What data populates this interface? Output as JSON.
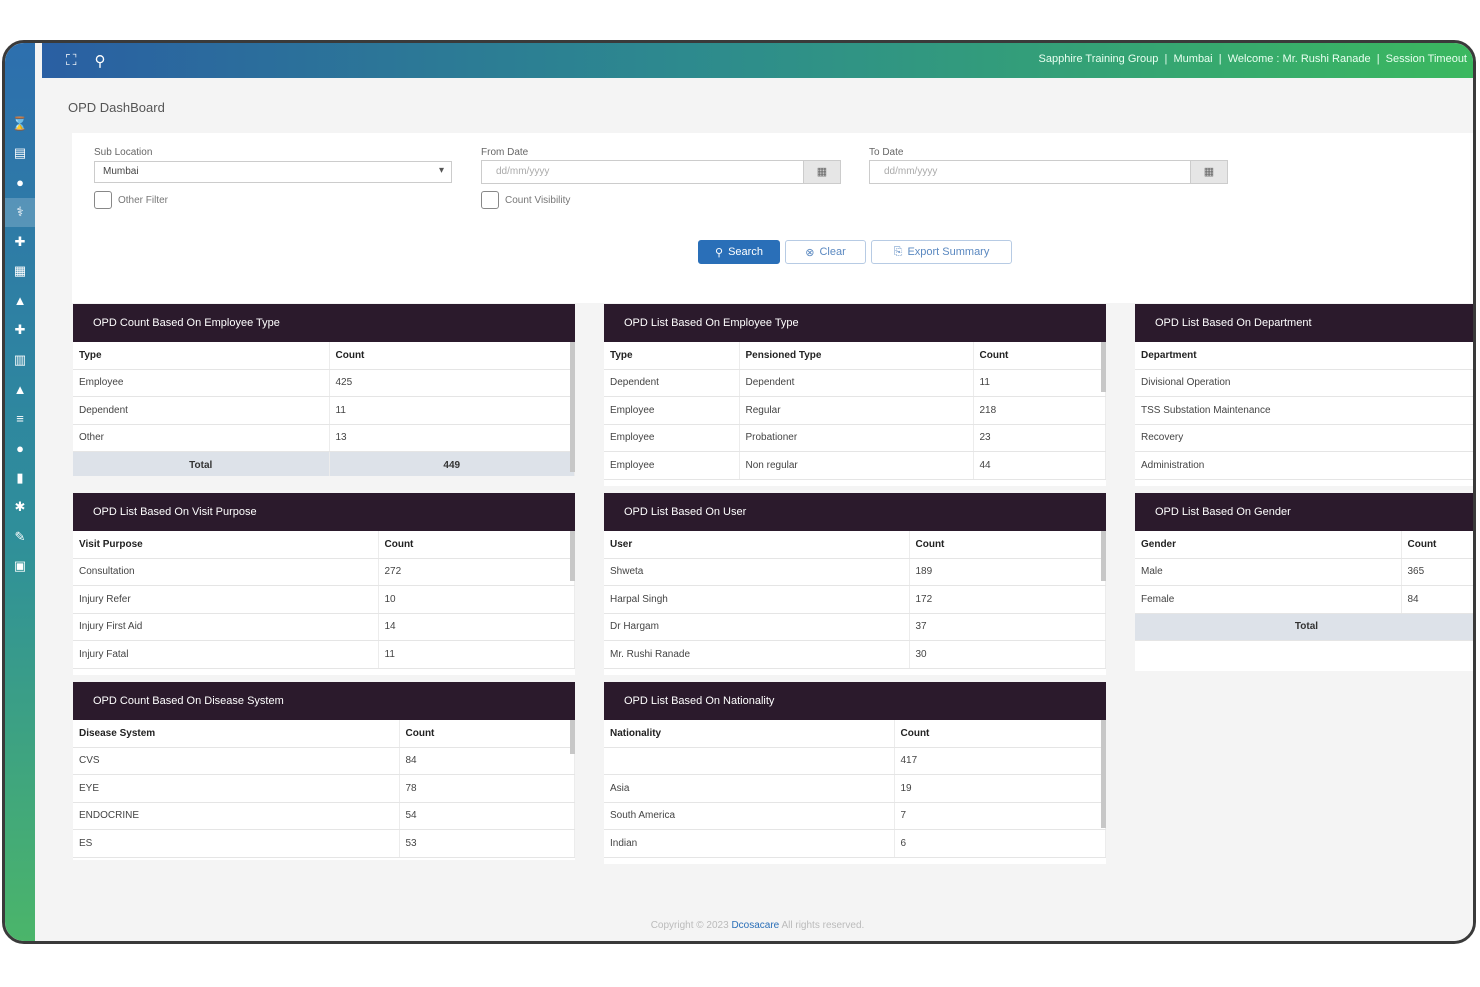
{
  "topbar": {
    "org": "Sapphire Training Group",
    "location": "Mumbai",
    "welcome": "Welcome : Mr. Rushi Ranade",
    "session": "Session Timeout"
  },
  "page": {
    "title": "OPD DashBoard"
  },
  "filters": {
    "sub_location_label": "Sub Location",
    "sub_location_value": "Mumbai",
    "from_date_label": "From Date",
    "from_date_placeholder": "dd/mm/yyyy",
    "to_date_label": "To Date",
    "to_date_placeholder": "dd/mm/yyyy",
    "other_filter_label": "Other Filter",
    "count_visibility_label": "Count Visibility"
  },
  "buttons": {
    "search": "Search",
    "clear": "Clear",
    "export": "Export Summary"
  },
  "cards": {
    "emp_type_count": {
      "title": "OPD Count Based On Employee Type",
      "headers": [
        "Type",
        "Count"
      ],
      "rows": [
        [
          "Employee",
          "425"
        ],
        [
          "Dependent",
          "11"
        ],
        [
          "Other",
          "13"
        ]
      ],
      "total_label": "Total",
      "total_value": "449"
    },
    "emp_type_list": {
      "title": "OPD List Based On Employee Type",
      "headers": [
        "Type",
        "Pensioned Type",
        "Count"
      ],
      "rows": [
        [
          "Dependent",
          "Dependent",
          "11"
        ],
        [
          "Employee",
          "Regular",
          "218"
        ],
        [
          "Employee",
          "Probationer",
          "23"
        ],
        [
          "Employee",
          "Non regular",
          "44"
        ]
      ]
    },
    "department": {
      "title": "OPD List Based On Department",
      "headers": [
        "Department"
      ],
      "rows": [
        [
          "Divisional Operation"
        ],
        [
          "TSS Substation Maintenance"
        ],
        [
          "Recovery"
        ],
        [
          "Administration"
        ]
      ]
    },
    "visit_purpose": {
      "title": "OPD List Based On Visit Purpose",
      "headers": [
        "Visit Purpose",
        "Count"
      ],
      "rows": [
        [
          "Consultation",
          "272"
        ],
        [
          "Injury Refer",
          "10"
        ],
        [
          "Injury First Aid",
          "14"
        ],
        [
          "Injury Fatal",
          "11"
        ]
      ]
    },
    "user": {
      "title": "OPD List Based On User",
      "headers": [
        "User",
        "Count"
      ],
      "rows": [
        [
          "Shweta",
          "189"
        ],
        [
          "Harpal Singh",
          "172"
        ],
        [
          "Dr Hargam",
          "37"
        ],
        [
          "Mr. Rushi Ranade",
          "30"
        ]
      ]
    },
    "gender": {
      "title": "OPD List Based On Gender",
      "headers": [
        "Gender",
        "Count"
      ],
      "rows": [
        [
          "Male",
          "365"
        ],
        [
          "Female",
          "84"
        ]
      ],
      "total_label": "Total"
    },
    "disease": {
      "title": "OPD Count Based On Disease System",
      "headers": [
        "Disease System",
        "Count"
      ],
      "rows": [
        [
          "CVS",
          "84"
        ],
        [
          "EYE",
          "78"
        ],
        [
          "ENDOCRINE",
          "54"
        ],
        [
          "ES",
          "53"
        ]
      ]
    },
    "nationality": {
      "title": "OPD List Based On Nationality",
      "headers": [
        "Nationality",
        "Count"
      ],
      "rows": [
        [
          "",
          "417"
        ],
        [
          "Asia",
          "19"
        ],
        [
          "South America",
          "7"
        ],
        [
          "Indian",
          "6"
        ]
      ]
    }
  },
  "footer": {
    "prefix": "Copyright © 2023",
    "brand": "Dcosacare",
    "suffix": "All rights reserved."
  }
}
